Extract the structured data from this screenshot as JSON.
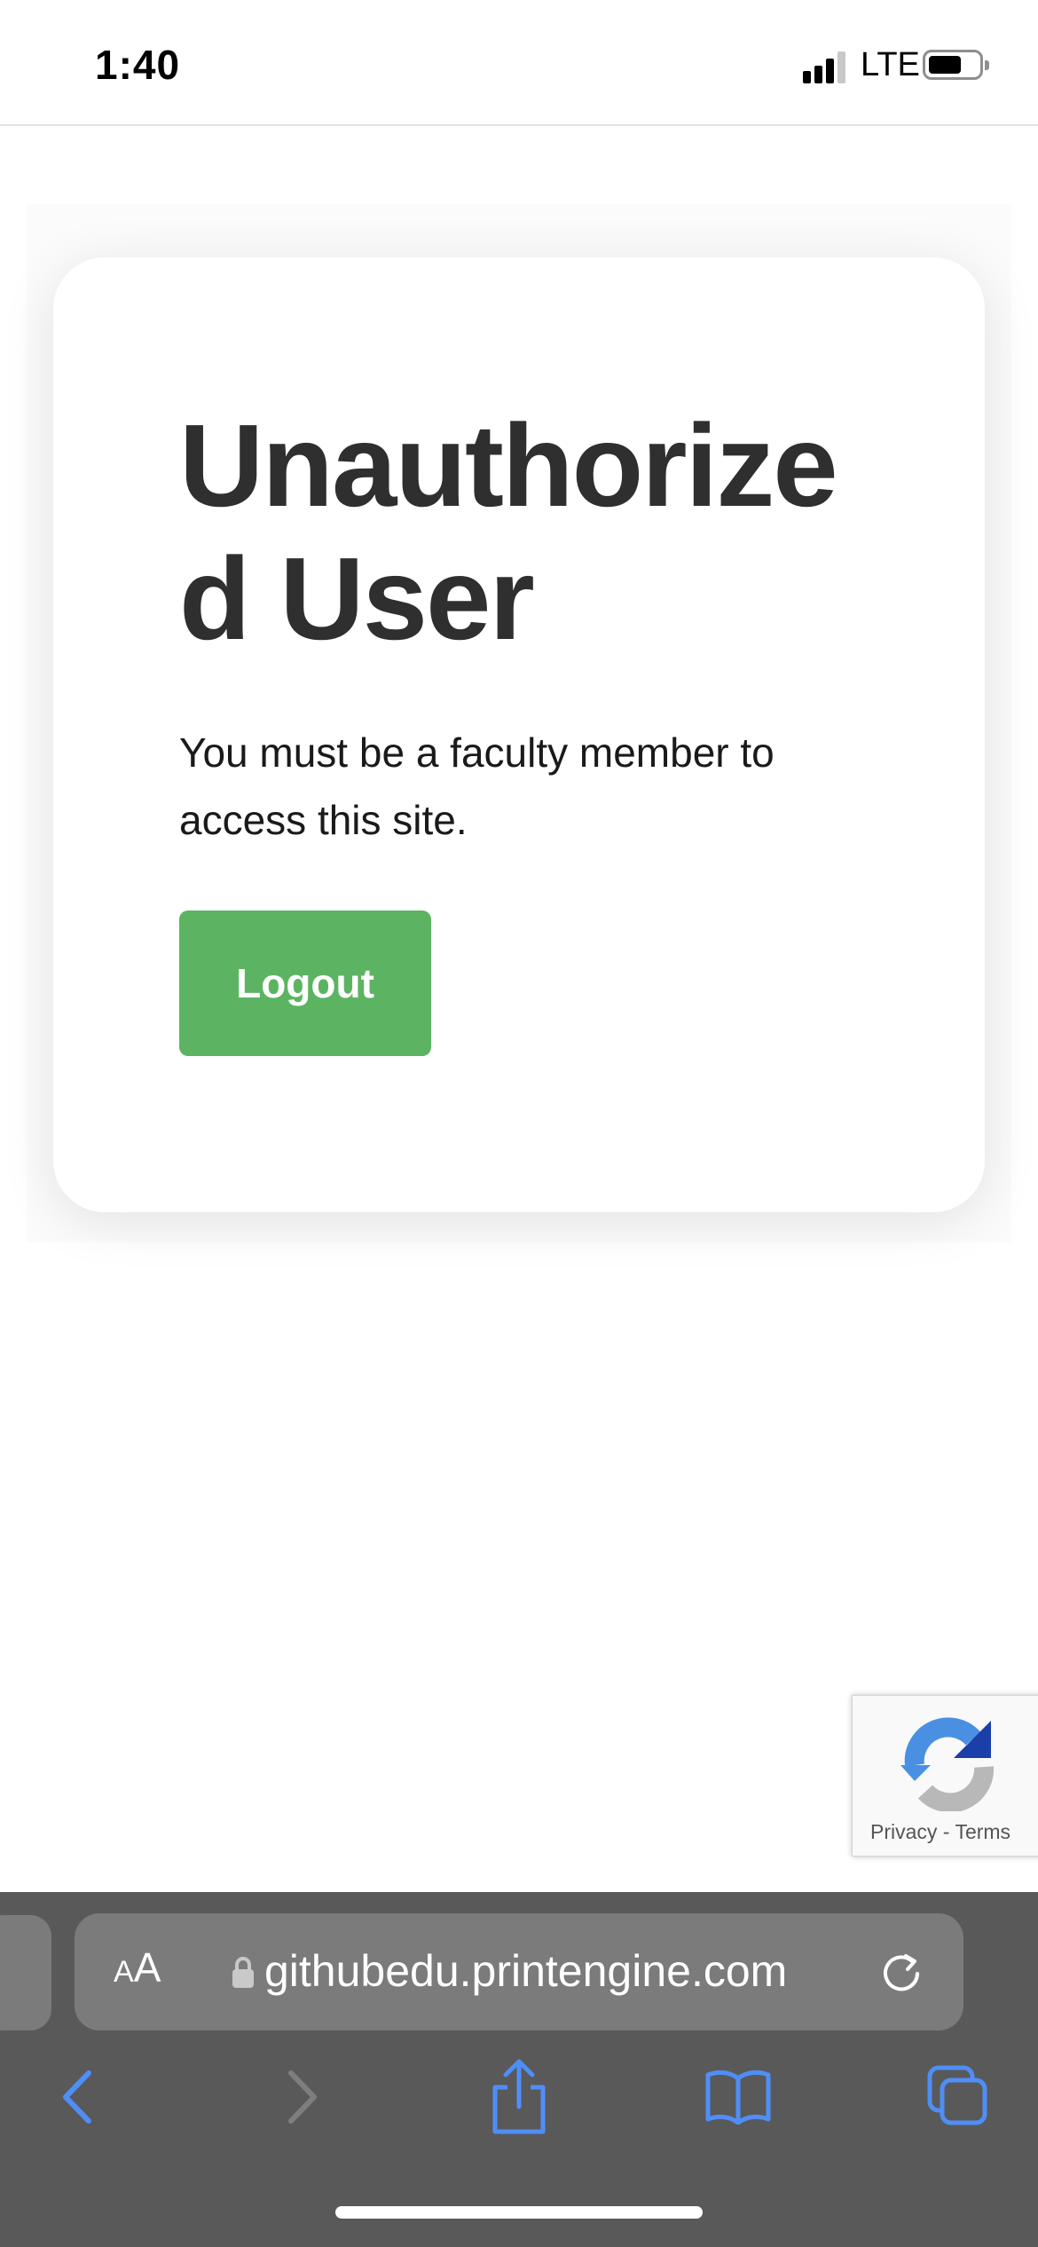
{
  "status_bar": {
    "time": "1:40",
    "network": "LTE",
    "signal_bars_active": 3,
    "signal_bars_total": 4,
    "battery_level": 0.55
  },
  "card": {
    "title": "Unauthorized User",
    "message": "You must be a faculty member to access this site.",
    "logout_label": "Logout"
  },
  "recaptcha": {
    "privacy_label": "Privacy",
    "separator": " - ",
    "terms_label": "Terms"
  },
  "browser": {
    "text_size_small": "A",
    "text_size_large": "A",
    "url": "githubedu.printengine.com",
    "toolbar_icons": [
      "back-icon",
      "forward-icon",
      "share-icon",
      "bookmarks-icon",
      "tabs-icon"
    ]
  },
  "colors": {
    "accent_green": "#5cb462",
    "browser_bar": "#595959",
    "toolbar_icon": "#4f8ef7",
    "toolbar_icon_disabled": "#7e7e7e"
  }
}
